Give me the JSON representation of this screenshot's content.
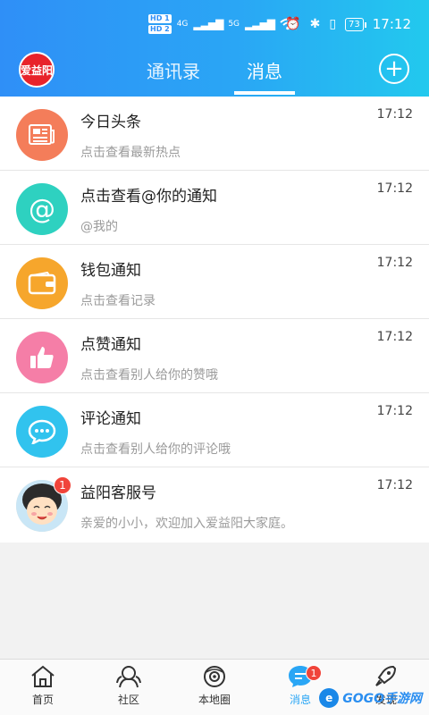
{
  "status_bar": {
    "hd1": "HD 1",
    "hd2": "HD 2",
    "net1": "4G",
    "net2": "5G",
    "time": "17:12",
    "battery": "73"
  },
  "header": {
    "logo_text": "爱益阳",
    "tabs": [
      {
        "label": "通讯录",
        "active": false
      },
      {
        "label": "消息",
        "active": true
      }
    ],
    "add_icon": "plus-icon"
  },
  "messages": [
    {
      "title": "今日头条",
      "subtitle": "点击查看最新热点",
      "time": "17:12",
      "icon": "newspaper-icon",
      "color": "#f47d5a"
    },
    {
      "title": "点击查看@你的通知",
      "subtitle": "@我的",
      "time": "17:12",
      "icon": "at-icon",
      "color": "#2ed1c0"
    },
    {
      "title": "钱包通知",
      "subtitle": "点击查看记录",
      "time": "17:12",
      "icon": "wallet-icon",
      "color": "#f6a62c"
    },
    {
      "title": "点赞通知",
      "subtitle": "点击查看别人给你的赞哦",
      "time": "17:12",
      "icon": "thumbs-up-icon",
      "color": "#f57ea7"
    },
    {
      "title": "评论通知",
      "subtitle": "点击查看别人给你的评论哦",
      "time": "17:12",
      "icon": "comment-icon",
      "color": "#31c3ee"
    },
    {
      "title": "益阳客服号",
      "subtitle": "亲爱的小小，欢迎加入爱益阳大家庭。",
      "time": "17:12",
      "icon": "service-avatar",
      "badge": "1"
    }
  ],
  "tabbar": {
    "items": [
      {
        "label": "首页",
        "icon": "home-icon"
      },
      {
        "label": "社区",
        "icon": "community-icon"
      },
      {
        "label": "本地圈",
        "icon": "local-circle-icon"
      },
      {
        "label": "消息",
        "icon": "message-icon",
        "badge": "1",
        "active": true
      },
      {
        "label": "发现",
        "icon": "rocket-icon"
      }
    ],
    "watermark": "GOGO手游网"
  }
}
